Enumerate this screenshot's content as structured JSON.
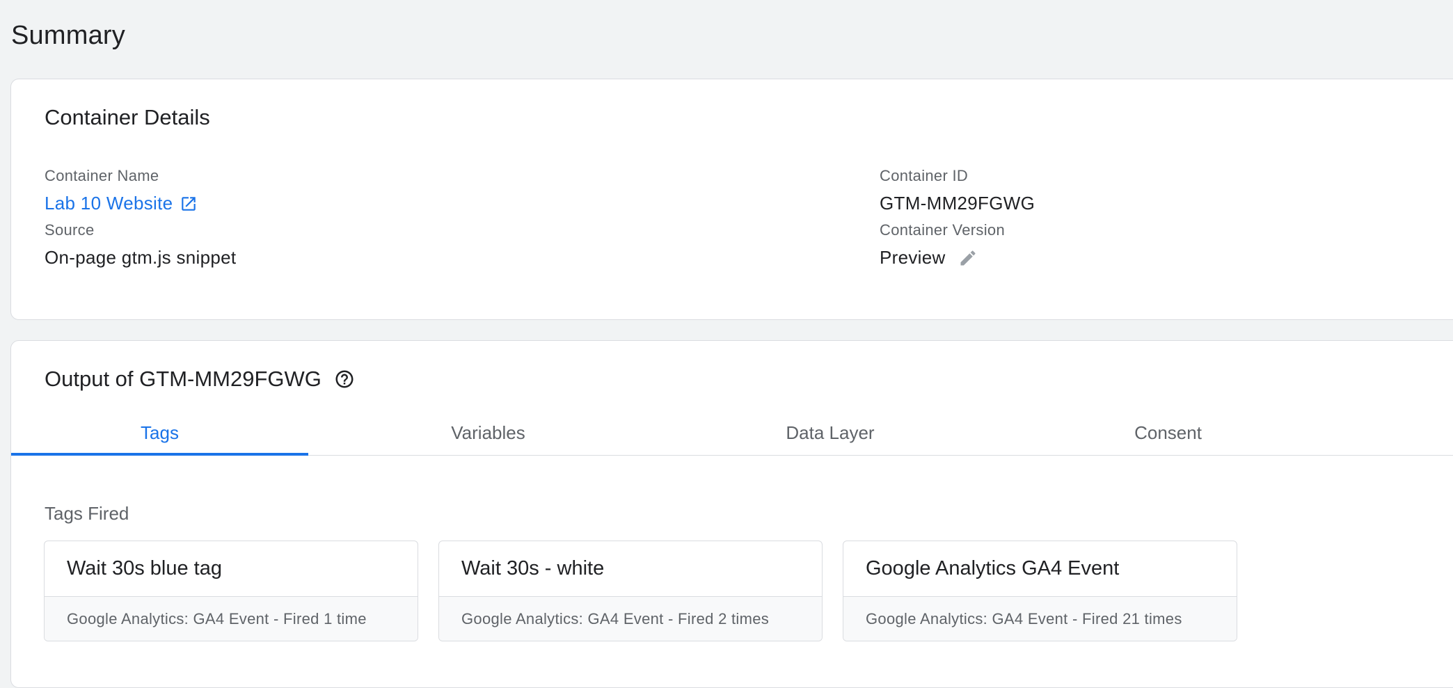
{
  "page": {
    "title": "Summary"
  },
  "container_details": {
    "heading": "Container Details",
    "name_label": "Container Name",
    "name_value": "Lab 10 Website",
    "id_label": "Container ID",
    "id_value": "GTM-MM29FGWG",
    "source_label": "Source",
    "source_value": "On-page gtm.js snippet",
    "version_label": "Container Version",
    "version_value": "Preview"
  },
  "output": {
    "heading": "Output of GTM-MM29FGWG",
    "tabs": [
      {
        "label": "Tags",
        "active": true
      },
      {
        "label": "Variables",
        "active": false
      },
      {
        "label": "Data Layer",
        "active": false
      },
      {
        "label": "Consent",
        "active": false
      }
    ],
    "tags_fired_label": "Tags Fired",
    "tags": [
      {
        "name": "Wait 30s blue tag",
        "meta": "Google Analytics: GA4 Event - Fired 1 time"
      },
      {
        "name": "Wait 30s - white",
        "meta": "Google Analytics: GA4 Event - Fired 2 times"
      },
      {
        "name": "Google Analytics GA4 Event",
        "meta": "Google Analytics: GA4 Event - Fired 21 times"
      }
    ]
  },
  "colors": {
    "accent": "#1a73e8",
    "background": "#f1f3f4",
    "text_primary": "#202124",
    "text_secondary": "#5f6368"
  },
  "icons": {
    "link": "open-in-new-icon",
    "edit": "pencil-icon",
    "help": "help-circle-icon"
  }
}
